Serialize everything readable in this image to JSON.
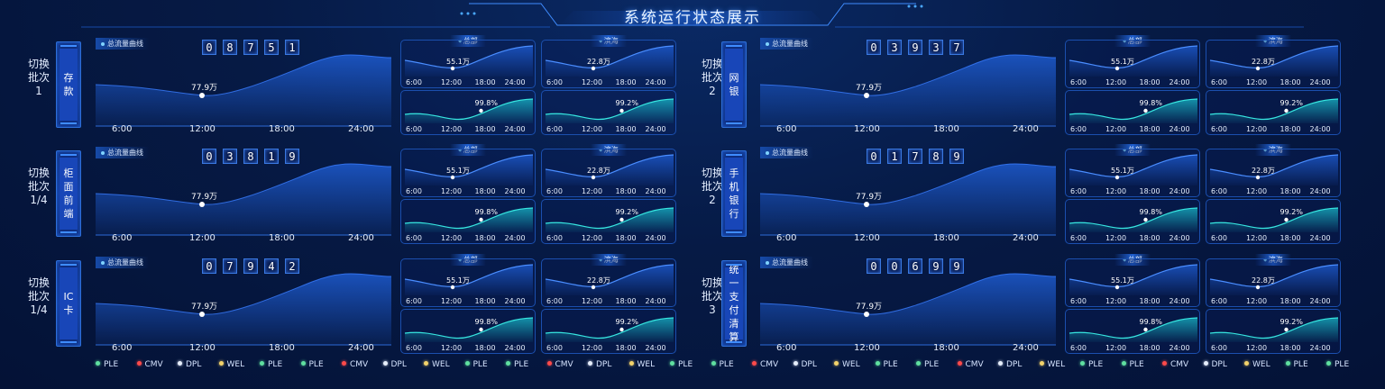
{
  "page_title": "系统运行状态展示",
  "total_curve_title": "总流量曲线",
  "hq_label": "总部",
  "binhai_label": "滨海",
  "big_ticks": [
    "6:00",
    "12:00",
    "18:00",
    "24:00"
  ],
  "mini_ticks": [
    "6:00",
    "12:00",
    "18:00",
    "24:00"
  ],
  "big_peak_label": "77.9万",
  "hq_top_peak": "55.1万",
  "bh_top_peak": "22.8万",
  "bh_top_peak_alt": "22.8万",
  "hq_bottom_peak": "99.8%",
  "bh_bottom_peak": "99.2%",
  "panels": [
    {
      "batch_label": "切换批次1",
      "system": "存款",
      "digits": [
        "0",
        "8",
        "7",
        "5",
        "1"
      ]
    },
    {
      "batch_label": "切换批次2",
      "system": "网银",
      "digits": [
        "0",
        "3",
        "9",
        "3",
        "7"
      ]
    },
    {
      "batch_label": "切换批次1/4",
      "system": "柜面前端",
      "digits": [
        "0",
        "3",
        "8",
        "1",
        "9"
      ]
    },
    {
      "batch_label": "切换批次2",
      "system": "手机银行",
      "digits": [
        "0",
        "1",
        "7",
        "8",
        "9"
      ]
    },
    {
      "batch_label": "切换批次1/4",
      "system": "IC卡",
      "digits": [
        "0",
        "7",
        "9",
        "4",
        "2"
      ]
    },
    {
      "batch_label": "切换批次3",
      "system": "统一支付清算",
      "digits": [
        "0",
        "0",
        "6",
        "9",
        "9"
      ]
    }
  ],
  "legend": [
    {
      "label": "PLE",
      "color": "#5fe0a0"
    },
    {
      "label": "CMV",
      "color": "#ff4a4a"
    },
    {
      "label": "DPL",
      "color": "#e6eefc"
    },
    {
      "label": "WEL",
      "color": "#f3d36b"
    },
    {
      "label": "PLE",
      "color": "#5fe0a0"
    },
    {
      "label": "PLE",
      "color": "#5fe0a0"
    },
    {
      "label": "CMV",
      "color": "#ff4a4a"
    },
    {
      "label": "DPL",
      "color": "#e6eefc"
    },
    {
      "label": "WEL",
      "color": "#f3d36b"
    },
    {
      "label": "PLE",
      "color": "#5fe0a0"
    },
    {
      "label": "PLE",
      "color": "#5fe0a0"
    },
    {
      "label": "CMV",
      "color": "#ff4a4a"
    },
    {
      "label": "DPL",
      "color": "#e6eefc"
    },
    {
      "label": "WEL",
      "color": "#f3d36b"
    },
    {
      "label": "PLE",
      "color": "#5fe0a0"
    },
    {
      "label": "PLE",
      "color": "#5fe0a0"
    },
    {
      "label": "CMV",
      "color": "#ff4a4a"
    },
    {
      "label": "DPL",
      "color": "#e6eefc"
    },
    {
      "label": "WEL",
      "color": "#f3d36b"
    },
    {
      "label": "PLE",
      "color": "#5fe0a0"
    },
    {
      "label": "PLE",
      "color": "#5fe0a0"
    },
    {
      "label": "CMV",
      "color": "#ff4a4a"
    },
    {
      "label": "DPL",
      "color": "#e6eefc"
    },
    {
      "label": "WEL",
      "color": "#f3d36b"
    },
    {
      "label": "PLE",
      "color": "#5fe0a0"
    },
    {
      "label": "PLE",
      "color": "#5fe0a0"
    },
    {
      "label": "CMV",
      "color": "#ff4a4a"
    },
    {
      "label": "DPL",
      "color": "#e6eefc"
    },
    {
      "label": "WEL",
      "color": "#f3d36b"
    },
    {
      "label": "PLE",
      "color": "#5fe0a0"
    },
    {
      "label": "PLE",
      "color": "#5fe0a0"
    }
  ],
  "colors": {
    "area_blue": "#1f5fd8",
    "area_teal": "#19b9c9",
    "line_blue": "#4a8dff",
    "line_teal": "#37e6e0"
  }
}
